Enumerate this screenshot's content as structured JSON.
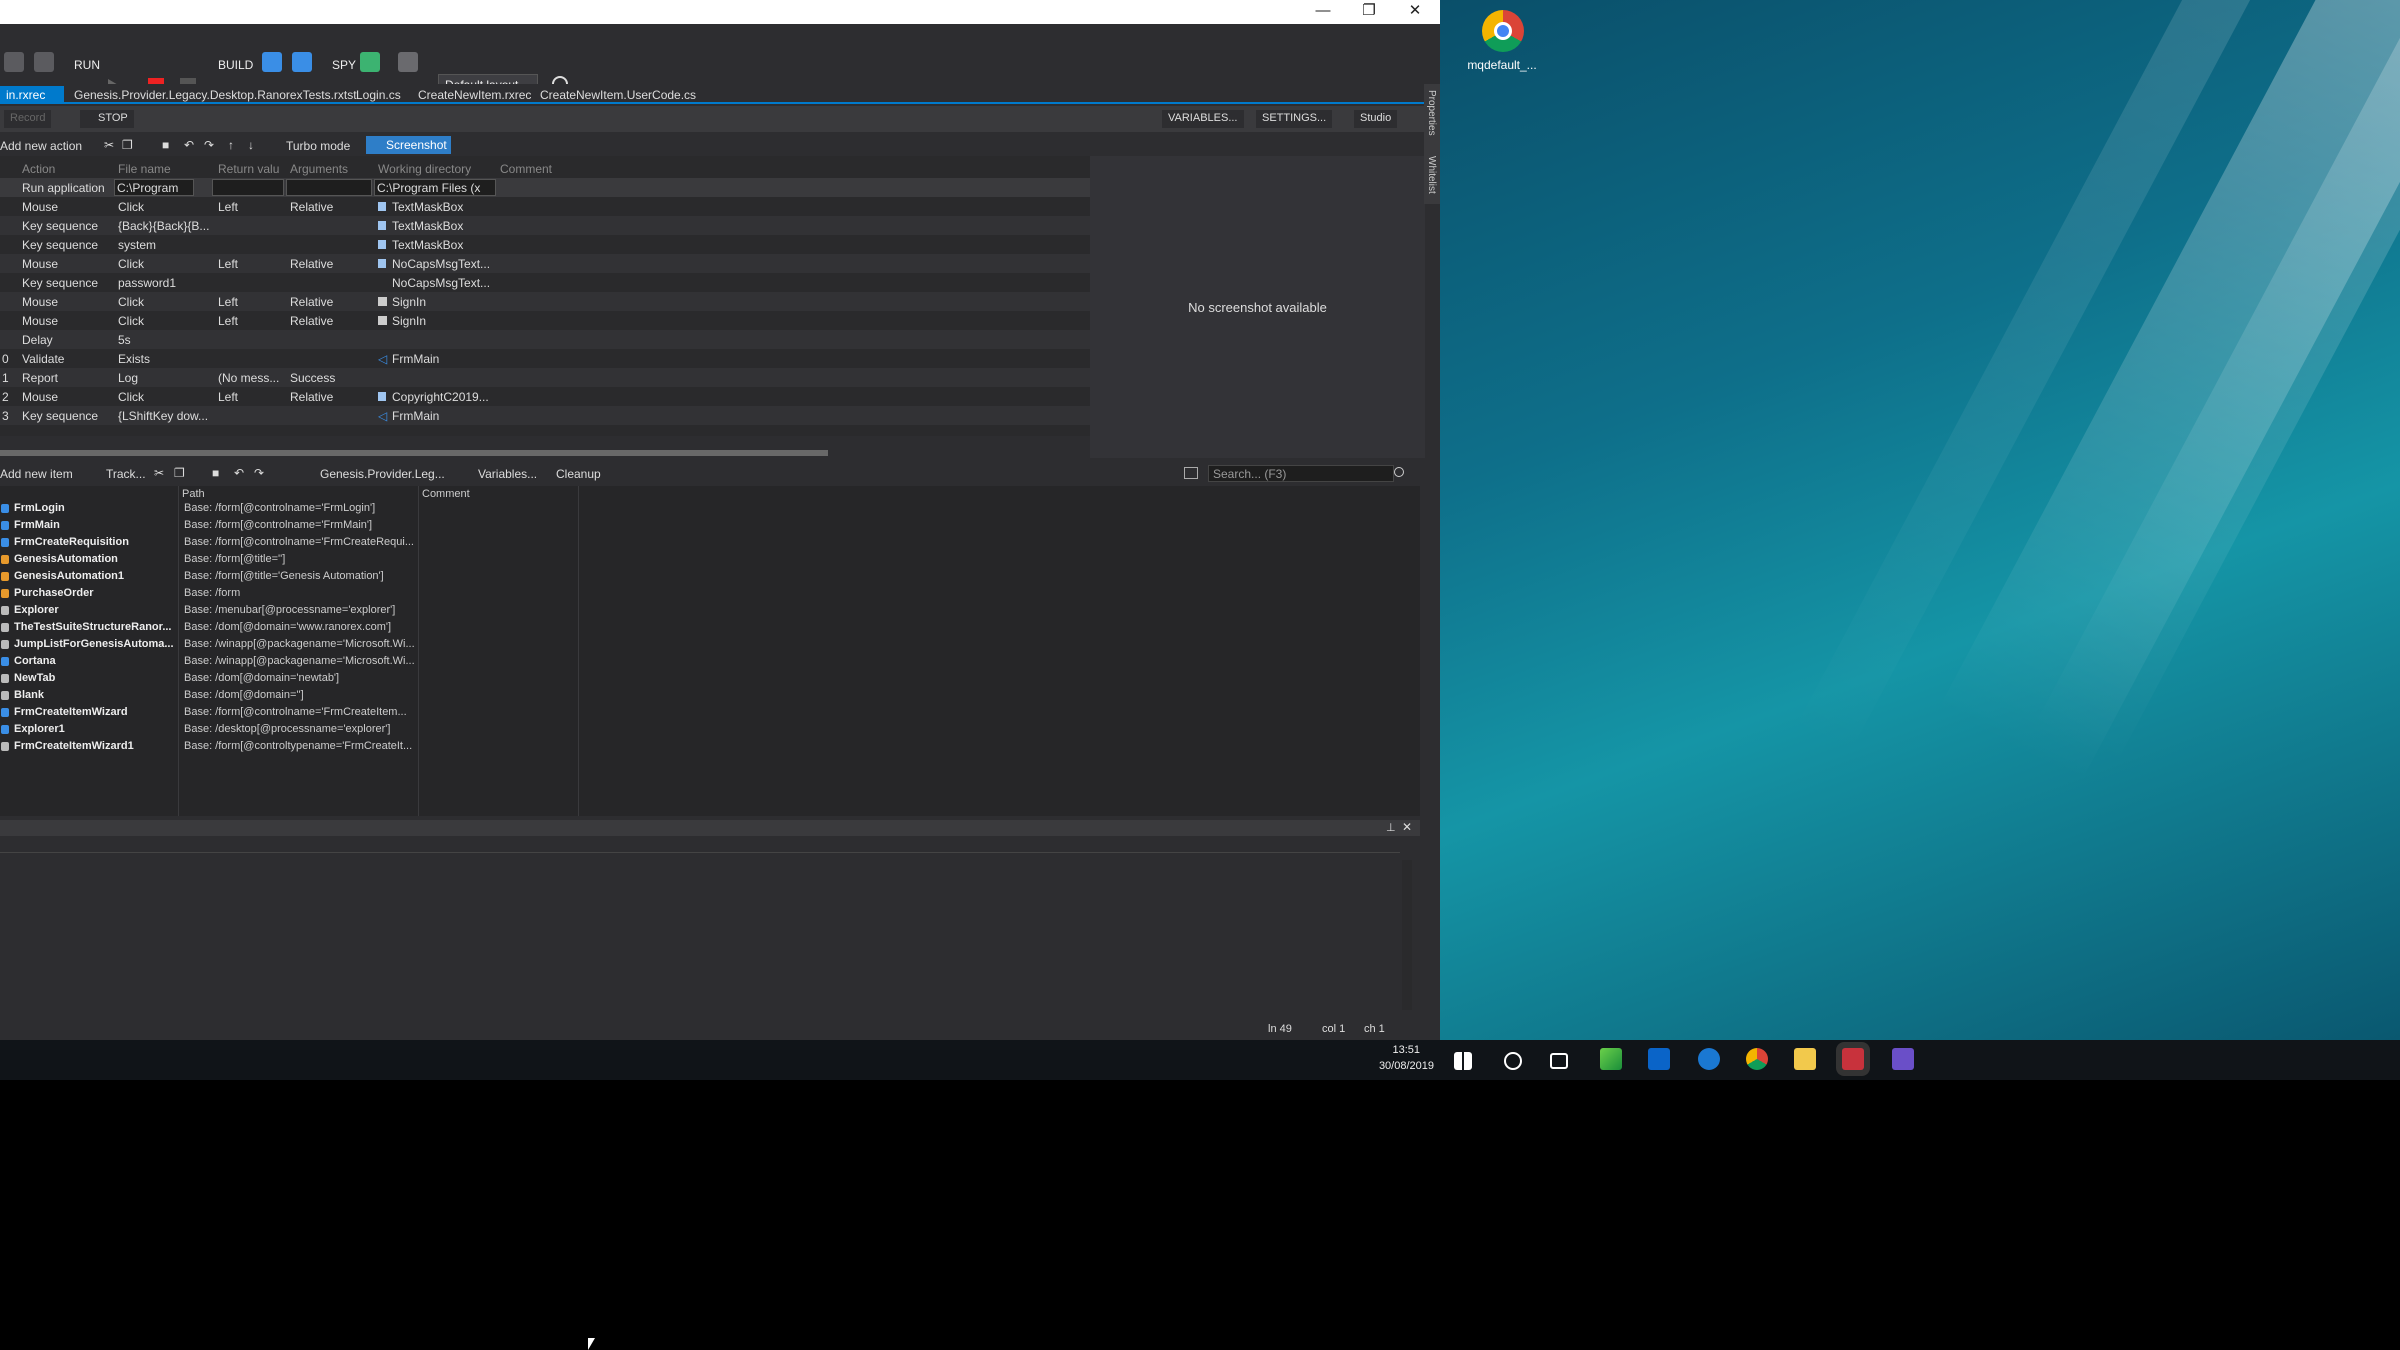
{
  "window": {
    "min": "—",
    "restore": "❐",
    "close": "✕"
  },
  "toolbar": {
    "run": "RUN",
    "build": "BUILD",
    "spy": "SPY",
    "layout": "Default layout"
  },
  "tabs": [
    {
      "label": "in.rxrec"
    },
    {
      "label": "Genesis.Provider.Legacy.Desktop.RanorexTests.rxtst"
    },
    {
      "label": "Login.cs"
    },
    {
      "label": "CreateNewItem.rxrec"
    },
    {
      "label": "CreateNewItem.UserCode.cs"
    }
  ],
  "runbar": {
    "record": "Record",
    "stop": "STOP",
    "variables": "VARIABLES...",
    "settings": "SETTINGS...",
    "studio": "Studio"
  },
  "actbar": {
    "add": "Add new action",
    "turbo": "Turbo mode",
    "screenshot": "Screenshot"
  },
  "grid": {
    "headers": [
      "Action",
      "File name",
      "Return valu",
      "Arguments",
      "Working directory",
      "Comment"
    ],
    "first": {
      "action": "Run application",
      "file": "C:\\Program",
      "workdir": "C:\\Program Files (x"
    },
    "rows": [
      {
        "n": "",
        "action": "Mouse",
        "a": "Click",
        "b": "Left",
        "c": "Relative",
        "target": "TextMaskBox"
      },
      {
        "n": "",
        "action": "Key sequence",
        "a": "{Back}{Back}{B...",
        "b": "",
        "c": "",
        "target": "TextMaskBox"
      },
      {
        "n": "",
        "action": "Key sequence",
        "a": "system",
        "b": "",
        "c": "",
        "target": "TextMaskBox"
      },
      {
        "n": "",
        "action": "Mouse",
        "a": "Click",
        "b": "Left",
        "c": "Relative",
        "target": "NoCapsMsgText..."
      },
      {
        "n": "",
        "action": "Key sequence",
        "a": "password1",
        "b": "",
        "c": "",
        "target": "NoCapsMsgText..."
      },
      {
        "n": "",
        "action": "Mouse",
        "a": "Click",
        "b": "Left",
        "c": "Relative",
        "target": "SignIn"
      },
      {
        "n": "",
        "action": "Mouse",
        "a": "Click",
        "b": "Left",
        "c": "Relative",
        "target": "SignIn"
      },
      {
        "n": "",
        "action": "Delay",
        "a": "5s",
        "b": "",
        "c": "",
        "target": ""
      },
      {
        "n": "0",
        "action": "Validate",
        "a": "Exists",
        "b": "",
        "c": "",
        "target": "FrmMain"
      },
      {
        "n": "1",
        "action": "Report",
        "a": "Log",
        "b": "(No mess...",
        "c": "Success",
        "target": ""
      },
      {
        "n": "2",
        "action": "Mouse",
        "a": "Click",
        "b": "Left",
        "c": "Relative",
        "target": "CopyrightC2019..."
      },
      {
        "n": "3",
        "action": "Key sequence",
        "a": "{LShiftKey dow...",
        "b": "",
        "c": "",
        "target": "FrmMain"
      }
    ]
  },
  "screenshot_panel": {
    "text": "No screenshot available"
  },
  "repobar": {
    "add": "Add new item",
    "track": "Track...",
    "repo": "Genesis.Provider.Leg...",
    "variables": "Variables...",
    "cleanup": "Cleanup",
    "search": "Search... (F3)"
  },
  "repo": {
    "headers": [
      "Path",
      "Comment"
    ],
    "items": [
      {
        "name": "FrmLogin",
        "path": "Base: /form[@controlname='FrmLogin']",
        "color": "#3a8ee6"
      },
      {
        "name": "FrmMain",
        "path": "Base: /form[@controlname='FrmMain']",
        "color": "#3a8ee6"
      },
      {
        "name": "FrmCreateRequisition",
        "path": "Base: /form[@controlname='FrmCreateRequi...",
        "color": "#3a8ee6"
      },
      {
        "name": "GenesisAutomation",
        "path": "Base: /form[@title='']",
        "color": "#e89a2c"
      },
      {
        "name": "GenesisAutomation1",
        "path": "Base: /form[@title='Genesis Automation']",
        "color": "#e89a2c"
      },
      {
        "name": "PurchaseOrder",
        "path": "Base: /form",
        "color": "#e89a2c"
      },
      {
        "name": "Explorer",
        "path": "Base: /menubar[@processname='explorer']",
        "color": "#bbbbbb"
      },
      {
        "name": "TheTestSuiteStructureRanor...",
        "path": "Base: /dom[@domain='www.ranorex.com']",
        "color": "#bbbbbb"
      },
      {
        "name": "JumpListForGenesisAutoma...",
        "path": "Base: /winapp[@packagename='Microsoft.Wi...",
        "color": "#bbbbbb"
      },
      {
        "name": "Cortana",
        "path": "Base: /winapp[@packagename='Microsoft.Wi...",
        "color": "#3a8ee6"
      },
      {
        "name": "NewTab",
        "path": "Base: /dom[@domain='newtab']",
        "color": "#bbbbbb"
      },
      {
        "name": "Blank",
        "path": "Base: /dom[@domain='']",
        "color": "#bbbbbb"
      },
      {
        "name": "FrmCreateItemWizard",
        "path": "Base: /form[@controlname='FrmCreateItem...",
        "color": "#3a8ee6"
      },
      {
        "name": "Explorer1",
        "path": "Base: /desktop[@processname='explorer']",
        "color": "#3a8ee6"
      },
      {
        "name": "FrmCreateItemWizard1",
        "path": "Base: /form[@controltypename='FrmCreateIt...",
        "color": "#bbbbbb"
      }
    ]
  },
  "sidepanel": {
    "properties": "Properties",
    "whitelist": "Whitelist"
  },
  "status": {
    "ln": "ln 49",
    "col": "col 1",
    "ch": "ch 1"
  },
  "desktop": {
    "chrome_label": "mqdefault_..."
  },
  "taskbar": {
    "time": "13:51",
    "date": "30/08/2019"
  }
}
